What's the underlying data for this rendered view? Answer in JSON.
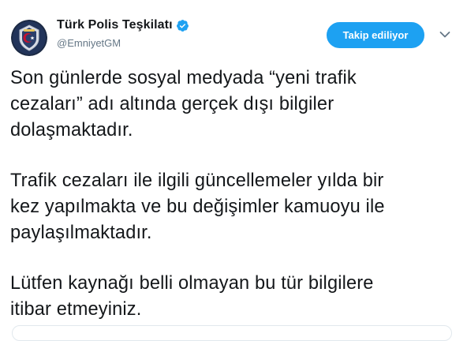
{
  "tweet": {
    "author": {
      "display_name": "Türk Polis Teşkilatı",
      "handle": "@EmniyetGM",
      "avatar_icon": "police-emblem-icon",
      "verified_icon": "verified-badge-icon"
    },
    "follow_button_label": "Takip ediliyor",
    "more_icon": "chevron-down-icon",
    "paragraphs": [
      "Son günlerde sosyal medyada “yeni trafik\ncezaları” adı altında gerçek dışı bilgiler\ndolaşmaktadır.",
      "Trafik cezaları ile ilgili güncellemeler yılda bir\nkez yapılmakta ve bu değişimler kamuoyu ile\npaylaşılmaktadır.",
      "Lütfen kaynağı belli olmayan bu tür bilgilere\nitibar etmeyiniz."
    ]
  },
  "colors": {
    "accent": "#1da1f2",
    "text_primary": "#14171a",
    "text_secondary": "#657786",
    "border": "#e1e8ed"
  }
}
